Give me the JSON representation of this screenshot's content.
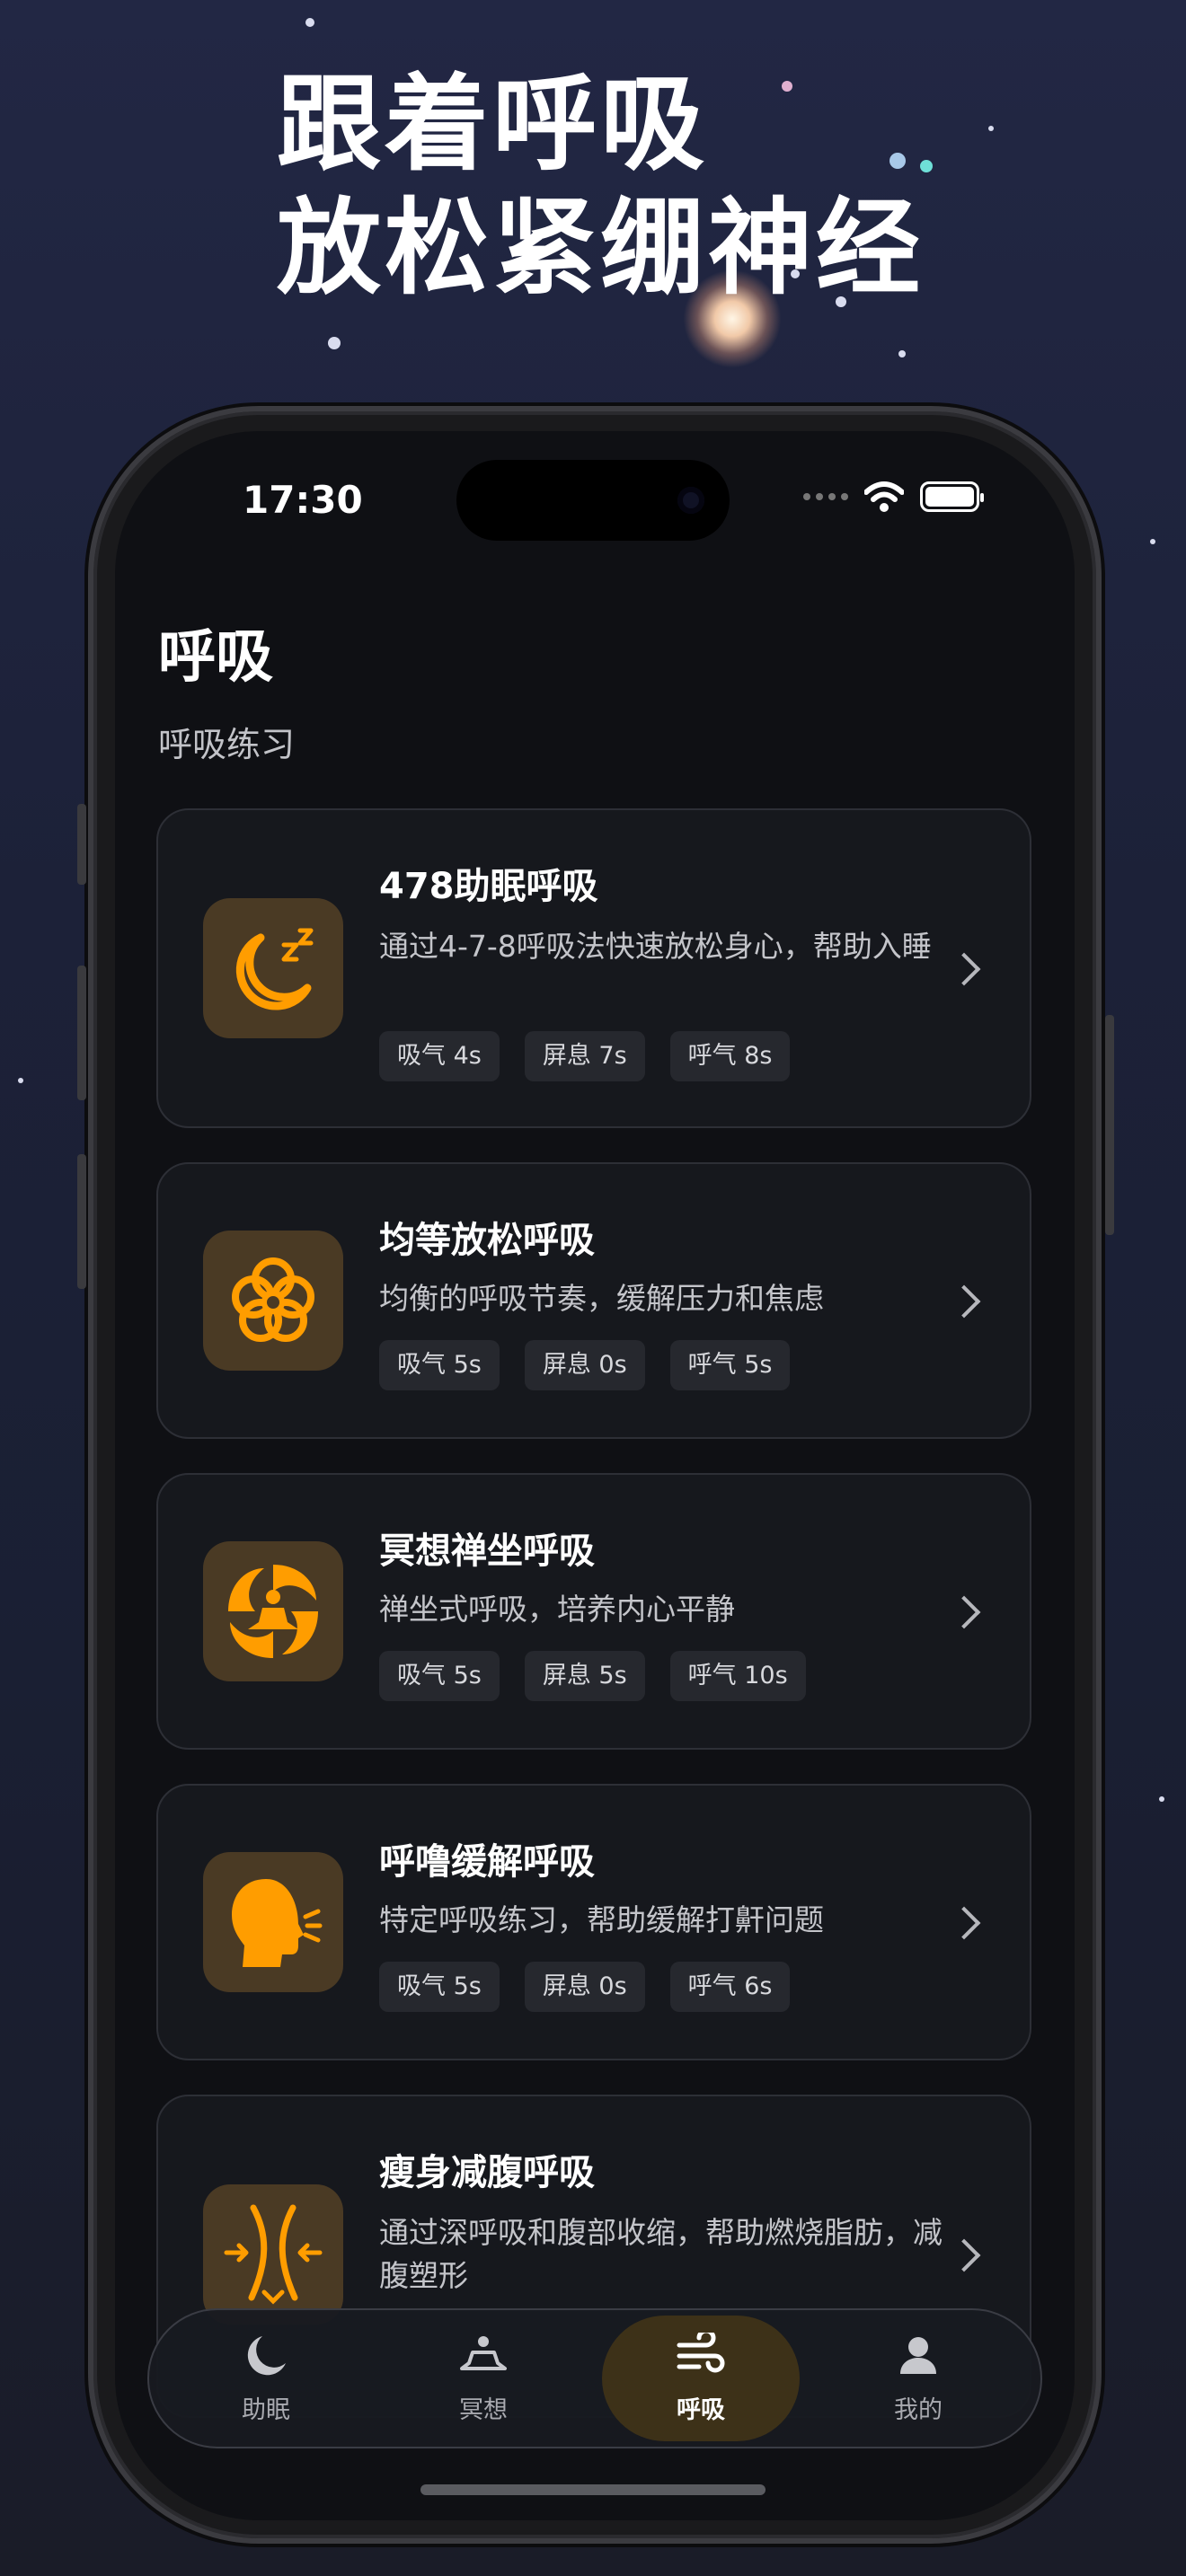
{
  "banner": {
    "line1": "跟着呼吸",
    "line2": "放松紧绷神经"
  },
  "status_bar": {
    "time": "17:30"
  },
  "page": {
    "title": "呼吸",
    "subtitle": "呼吸练习"
  },
  "cards": [
    {
      "title": "478助眠呼吸",
      "description": "通过4-7-8呼吸法快速放松身心，帮助入睡",
      "icon": "moon-zzz-icon",
      "chips": [
        "吸气 4s",
        "屏息 7s",
        "呼气 8s"
      ]
    },
    {
      "title": "均等放松呼吸",
      "description": "均衡的呼吸节奏，缓解压力和焦虑",
      "icon": "flower-icon",
      "chips": [
        "吸气 5s",
        "屏息 0s",
        "呼气 5s"
      ]
    },
    {
      "title": "冥想禅坐呼吸",
      "description": "禅坐式呼吸，培养内心平静",
      "icon": "meditation-swirl-icon",
      "chips": [
        "吸气 5s",
        "屏息 5s",
        "呼气 10s"
      ]
    },
    {
      "title": "呼噜缓解呼吸",
      "description": "特定呼吸练习，帮助缓解打鼾问题",
      "icon": "head-exhale-icon",
      "chips": [
        "吸气 5s",
        "屏息 0s",
        "呼气 6s"
      ]
    },
    {
      "title": "瘦身减腹呼吸",
      "description": "通过深呼吸和腹部收缩，帮助燃烧脂肪，减腹塑形",
      "icon": "waist-slim-icon",
      "chips": []
    }
  ],
  "tabs": [
    {
      "label": "助眠",
      "icon": "moon-icon"
    },
    {
      "label": "冥想",
      "icon": "meditation-icon"
    },
    {
      "label": "呼吸",
      "icon": "wind-icon",
      "active": true
    },
    {
      "label": "我的",
      "icon": "person-icon"
    }
  ],
  "colors": {
    "accent": "#ff9d00",
    "icon_tile": "#4a3a24",
    "active_tab": "#3d3118",
    "background": "#0f1014"
  }
}
